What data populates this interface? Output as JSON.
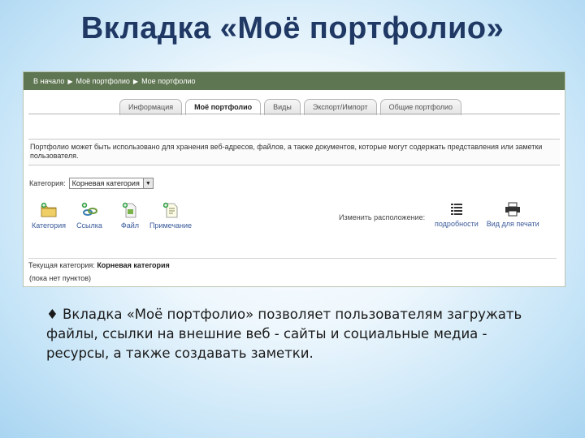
{
  "slide": {
    "title": "Вкладка «Моё портфолио»",
    "caption": "♦ Вкладка «Моё портфолио» позволяет пользователям загружать файлы, ссылки на внешние веб - сайты и социальные медиа - ресурсы, а также создавать заметки."
  },
  "breadcrumb": {
    "items": [
      "В начало",
      "Моё портфолио",
      "Мое портфолио"
    ],
    "separator": "▶"
  },
  "tabs": [
    {
      "label": "Информация",
      "active": false
    },
    {
      "label": "Моё портфолио",
      "active": true
    },
    {
      "label": "Виды",
      "active": false
    },
    {
      "label": "Экспорт/Импорт",
      "active": false
    },
    {
      "label": "Общие портфолио",
      "active": false
    }
  ],
  "description": "Портфолио может быть использовано для хранения веб-адресов, файлов, а также документов, которые могут содержать представления или заметки пользователя.",
  "category": {
    "label": "Категория:",
    "selected": "Корневая категория"
  },
  "tools": {
    "category": {
      "label": "Категория",
      "icon": "folder-icon"
    },
    "link": {
      "label": "Ссылка",
      "icon": "link-icon"
    },
    "file": {
      "label": "Файл",
      "icon": "file-icon"
    },
    "note": {
      "label": "Примечание",
      "icon": "note-icon"
    }
  },
  "layout_link": "Изменить расположение:",
  "view": {
    "details": {
      "label": "подробности",
      "icon": "list-icon"
    },
    "print": {
      "label": "Вид для печати",
      "icon": "printer-icon"
    }
  },
  "current_category": {
    "label": "Текущая категория:",
    "value": "Корневая категория"
  },
  "empty_text": "(пока нет пунктов)",
  "colors": {
    "title": "#1f3864",
    "topbar": "#5f7652",
    "link": "#3a5a9a"
  }
}
